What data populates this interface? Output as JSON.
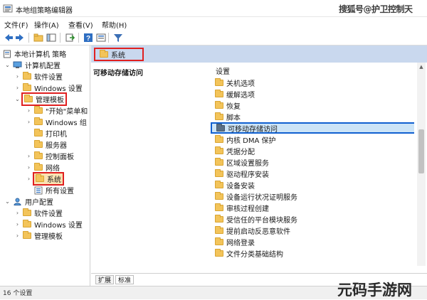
{
  "window": {
    "title": "本地组策略编辑器",
    "watermark": "搜狐号@护卫控制天"
  },
  "menu": {
    "items": [
      "文件(F)",
      "操作(A)",
      "查看(V)",
      "帮助(H)"
    ]
  },
  "toolbar": {
    "buttons": [
      "back-icon",
      "forward-icon",
      "up-folder-icon",
      "show-hide-tree-icon",
      "export-list-icon",
      "help-icon",
      "properties-icon",
      "filter-icon"
    ]
  },
  "tree": {
    "root": "本地计算机 策略",
    "computer_config": "计算机配置",
    "software_settings": "软件设置",
    "windows_settings": "Windows 设置",
    "admin_templates": "管理模板",
    "start_menu": "\"开始\"菜单和",
    "windows_components": "Windows 组",
    "printers": "打印机",
    "servers": "服务器",
    "control_panel": "控制面板",
    "network": "网络",
    "system": "系统",
    "all_settings": "所有设置",
    "user_config": "用户配置",
    "user_software_settings": "软件设置",
    "user_windows_settings": "Windows 设置",
    "user_admin_templates": "管理模板"
  },
  "right_pane": {
    "header_title": "系统",
    "description_title": "可移动存储访问",
    "settings_column": "设置",
    "settings": [
      "关机选项",
      "缓解选项",
      "恢复",
      "脚本",
      "可移动存储访问",
      "内核 DMA 保护",
      "凭据分配",
      "区域设置服务",
      "驱动程序安装",
      "设备安装",
      "设备运行状况证明服务",
      "审核过程创建",
      "受信任的平台模块服务",
      "提前启动反恶意软件",
      "网络登录",
      "文件分类基础结构"
    ],
    "selected_index": 4
  },
  "tabs": [
    "扩展",
    "标准"
  ],
  "status": {
    "text": "16 个设置"
  },
  "logo": "元码手游网"
}
